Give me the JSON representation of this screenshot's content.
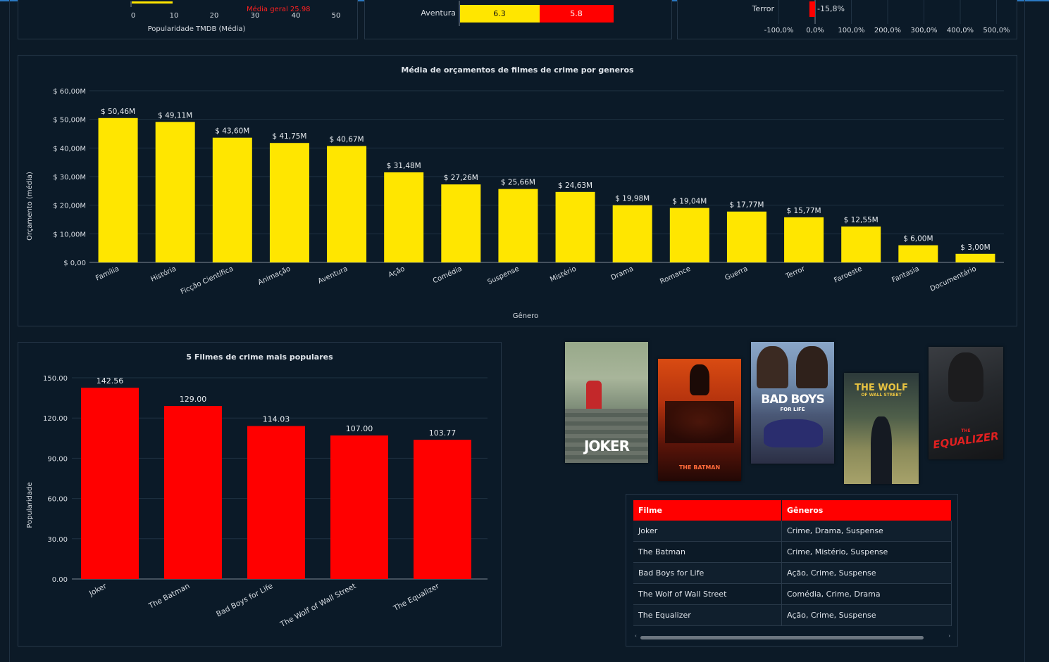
{
  "colors": {
    "bg": "#0c1a27",
    "yellow": "#ffe600",
    "red": "#ff0000",
    "accent": "#2b79c2"
  },
  "top_panels": {
    "popularity": {
      "ticks": [
        "0",
        "10",
        "20",
        "30",
        "40",
        "50"
      ],
      "avg_label": "Média geral 25.98",
      "xlabel": "Popularidade TMDB (Média)"
    },
    "rating": {
      "category": "Aventura",
      "values": [
        6.3,
        5.8
      ],
      "labels": [
        "6.3",
        "5.8"
      ]
    },
    "variation": {
      "category": "Terror",
      "value_label": "-15,8%",
      "value": -15.8,
      "ticks": [
        "-100,0%",
        "0,0%",
        "100,0%",
        "200,0%",
        "300,0%",
        "400,0%",
        "500,0%"
      ]
    }
  },
  "budget_chart": {
    "title": "Média de orçamentos de filmes de crime por generos",
    "xlabel": "Gênero",
    "ylabel": "Orçamento (média)",
    "yticks": [
      "$ 0,00",
      "$ 10,00M",
      "$ 20,00M",
      "$ 30,00M",
      "$ 40,00M",
      "$ 50,00M",
      "$ 60,00M"
    ],
    "labels": [
      "$ 50,46M",
      "$ 49,11M",
      "$ 43,60M",
      "$ 41,75M",
      "$ 40,67M",
      "$ 31,48M",
      "$ 27,26M",
      "$ 25,66M",
      "$ 24,63M",
      "$ 19,98M",
      "$ 19,04M",
      "$ 17,77M",
      "$ 15,77M",
      "$ 12,55M",
      "$ 6,00M",
      "$ 3,00M"
    ]
  },
  "popular_chart": {
    "title": "5 Filmes de crime mais populares",
    "ylabel": "Popularidade",
    "yticks": [
      "0.00",
      "30.00",
      "60.00",
      "90.00",
      "120.00",
      "150.00"
    ],
    "labels": [
      "142.56",
      "129.00",
      "114.03",
      "107.00",
      "103.77"
    ]
  },
  "chart_data": [
    {
      "type": "bar",
      "title": "Média de orçamentos de filmes de crime por generos",
      "xlabel": "Gênero",
      "ylabel": "Orçamento (média)",
      "categories": [
        "Família",
        "História",
        "Ficção Científica",
        "Animação",
        "Aventura",
        "Ação",
        "Comédia",
        "Suspense",
        "Mistério",
        "Drama",
        "Romance",
        "Guerra",
        "Terror",
        "Faroeste",
        "Fantasia",
        "Documentário"
      ],
      "values": [
        50.46,
        49.11,
        43.6,
        41.75,
        40.67,
        31.48,
        27.26,
        25.66,
        24.63,
        19.98,
        19.04,
        17.77,
        15.77,
        12.55,
        6.0,
        3.0
      ],
      "ylim": [
        0,
        60
      ],
      "grid": true,
      "color": "#ffe600"
    },
    {
      "type": "bar",
      "title": "5 Filmes de crime mais populares",
      "xlabel": "",
      "ylabel": "Popularidade",
      "categories": [
        "Joker",
        "The Batman",
        "Bad Boys for Life",
        "The Wolf of Wall Street",
        "The Equalizer"
      ],
      "values": [
        142.56,
        129.0,
        114.03,
        107.0,
        103.77
      ],
      "ylim": [
        0,
        150
      ],
      "grid": true,
      "color": "#ff0000"
    }
  ],
  "posters": [
    {
      "title": "JOKER",
      "sub": ""
    },
    {
      "title": "THE BATMAN",
      "sub": ""
    },
    {
      "title": "BAD BOYS",
      "sub": "FOR LIFE"
    },
    {
      "title": "THE WOLF",
      "sub": "OF WALL STREET"
    },
    {
      "title": "EQUALIZER",
      "sub": "THE"
    }
  ],
  "table": {
    "headers": [
      "Filme",
      "Gêneros"
    ],
    "rows": [
      [
        "Joker",
        "Crime, Drama, Suspense"
      ],
      [
        "The Batman",
        "Crime, Mistério, Suspense"
      ],
      [
        "Bad Boys for Life",
        "Ação, Crime, Suspense"
      ],
      [
        "The Wolf of Wall Street",
        "Comédia, Crime, Drama"
      ],
      [
        "The Equalizer",
        "Ação, Crime, Suspense"
      ]
    ]
  }
}
